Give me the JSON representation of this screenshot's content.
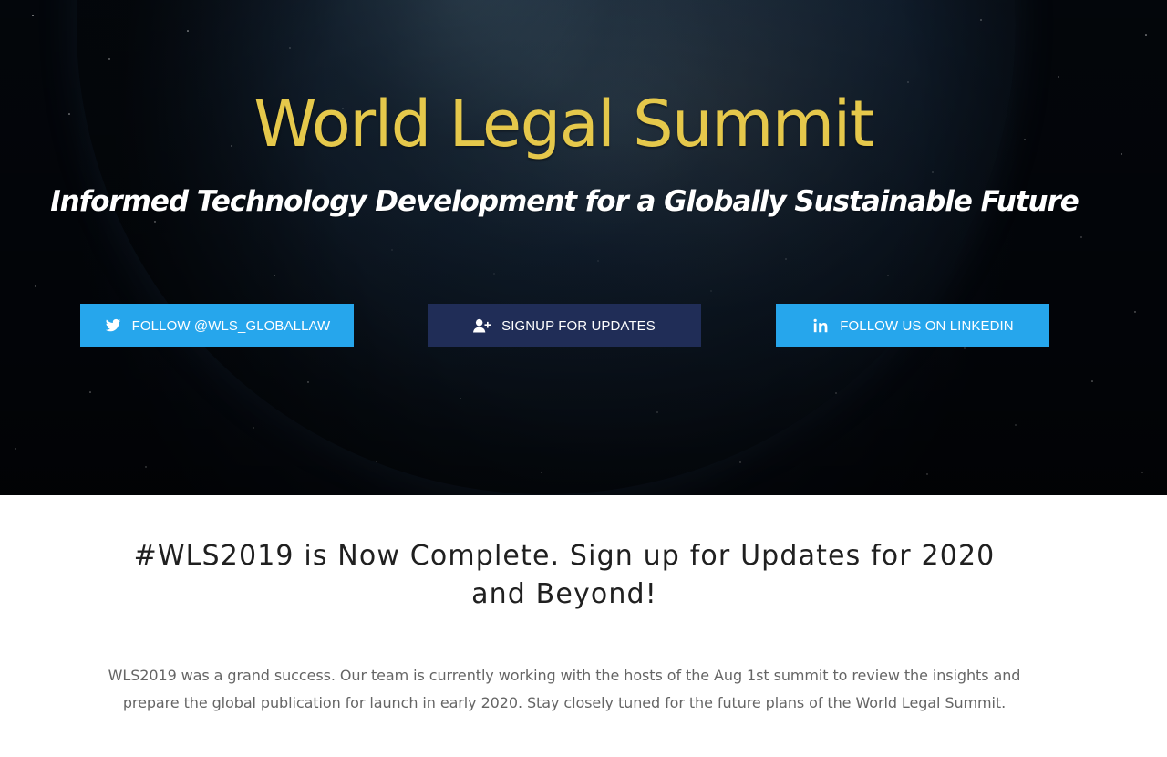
{
  "hero": {
    "title": "World Legal Summit",
    "subtitle": "Informed Technology Development for a Globally Sustainable Future",
    "buttons": {
      "twitter": {
        "label": "FOLLOW @WLS_GLOBALLAW",
        "icon": "twitter-icon",
        "color": "#26a6ec"
      },
      "signup": {
        "label": "SIGNUP FOR UPDATES",
        "icon": "user-plus-icon",
        "color": "#202d57"
      },
      "linkedin": {
        "label": "FOLLOW US ON LINKEDIN",
        "icon": "linkedin-icon",
        "color": "#26a6ec"
      }
    },
    "title_color": "#e5c84b"
  },
  "announcement": {
    "heading": "#WLS2019 is Now Complete. Sign up for Updates for 2020 and Beyond!",
    "body": "WLS2019 was a grand success. Our team is currently working with the hosts of the Aug 1st summit to review the insights and prepare the global publication for launch in early 2020. Stay closely tuned for the future plans of the World Legal Summit."
  }
}
